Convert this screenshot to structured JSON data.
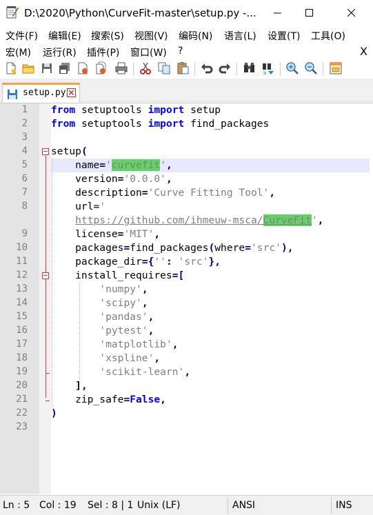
{
  "window": {
    "title": "D:\\2020\\Python\\CurveFit-master\\setup.py -..."
  },
  "menu_row1": [
    "文件(F)",
    "编辑(E)",
    "搜索(S)",
    "视图(V)",
    "编码(N)",
    "语言(L)",
    "设置(T)",
    "工具(O)"
  ],
  "menu_row2": [
    "宏(M)",
    "运行(R)",
    "插件(P)",
    "窗口(W)",
    "?"
  ],
  "menu_close": "X",
  "toolbar": {
    "icons": [
      "new-file-icon",
      "open-file-icon",
      "save-icon",
      "save-all-icon",
      "close-icon",
      "close-all-icon",
      "print-icon",
      "cut-icon",
      "copy-icon",
      "paste-icon",
      "undo-icon",
      "redo-icon",
      "find-icon",
      "replace-icon",
      "zoom-in-icon",
      "zoom-out-icon",
      "sync-scroll-icon"
    ]
  },
  "tab": {
    "label": "setup.py"
  },
  "editor": {
    "line_numbers": [
      "1",
      "2",
      "3",
      "4",
      "5",
      "6",
      "7",
      "8",
      "",
      "9",
      "10",
      "11",
      "12",
      "13",
      "14",
      "15",
      "16",
      "17",
      "18",
      "19",
      "20",
      "21",
      "22",
      "23"
    ],
    "lines": [
      "from setuptools import setup",
      "from setuptools import find_packages",
      "",
      "setup(",
      "    name='curvefit',",
      "    version='0.0.0',",
      "    description='Curve Fitting Tool',",
      "    url='",
      "    https://github.com/ihmeuw-msca/CurveFit',",
      "    license='MIT',",
      "    packages=find_packages(where='src'),",
      "    package_dir={'': 'src'},",
      "    install_requires=[",
      "        'numpy',",
      "        'scipy',",
      "        'pandas',",
      "        'pytest',",
      "        'matplotlib',",
      "        'xspline',",
      "        'scikit-learn',",
      "    ],",
      "    zip_safe=False,",
      ")",
      ""
    ]
  },
  "status": {
    "ln": "Ln : 5",
    "col": "Col : 19",
    "sel": "Sel : 8 | 1",
    "eol": "Unix (LF)",
    "encoding": "ANSI",
    "mode": "INS"
  },
  "colors": {
    "keyword": "#0000ff",
    "string": "#808080",
    "highlight": "#64d264",
    "fold": "#e0303a",
    "tab_accent": "#f9a03f"
  }
}
